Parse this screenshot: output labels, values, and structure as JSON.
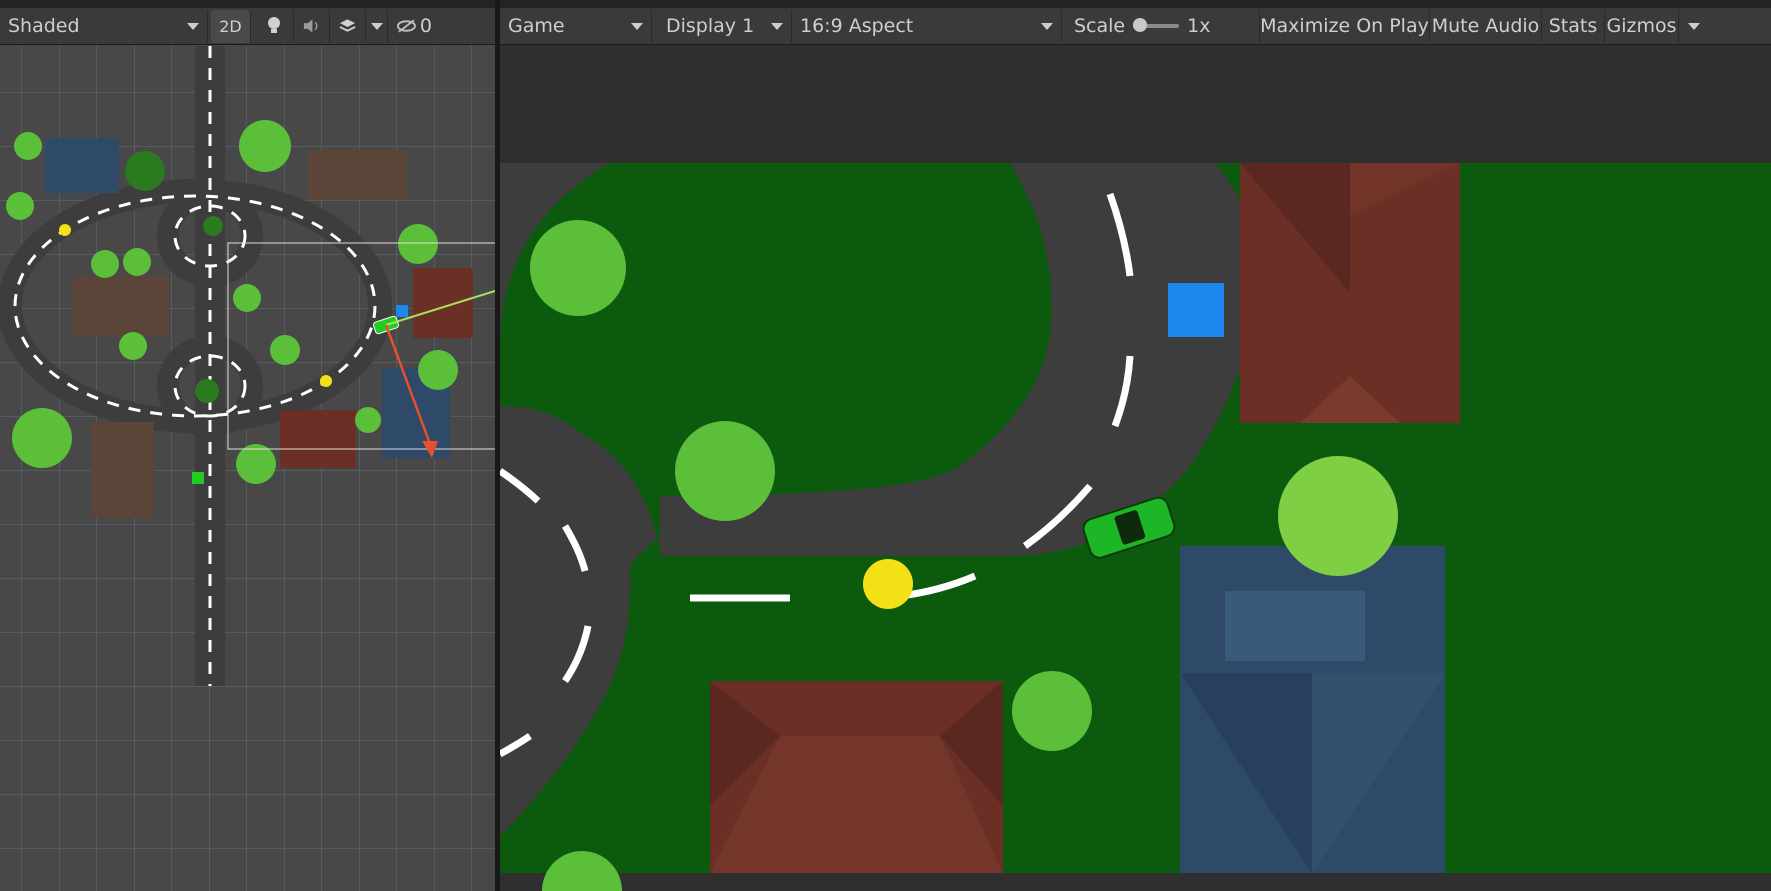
{
  "scene": {
    "shading_mode": "Shaded",
    "mode_2d_label": "2D",
    "hidden_count": "0"
  },
  "game": {
    "tab_label": "Game",
    "display_label": "Display 1",
    "aspect_label": "16:9 Aspect",
    "scale_label": "Scale",
    "scale_value": "1x",
    "maximize_label": "Maximize On Play",
    "mute_label": "Mute Audio",
    "stats_label": "Stats",
    "gizmos_label": "Gizmos"
  },
  "icons": [
    "lightbulb-icon",
    "speaker-icon",
    "layers-icon",
    "visibility-off-icon",
    "chevron-down-icon"
  ],
  "colors": {
    "editor_bg": "#3a3a3a",
    "scene_grid": "#484848",
    "grass": "#0c5a0d",
    "road": "#3d3d3d",
    "house_red": "#6b2f25",
    "house_blue": "#2f4a68",
    "car": "#1db626",
    "coin": "#f3e115",
    "checkpoint": "#1e87ee"
  }
}
